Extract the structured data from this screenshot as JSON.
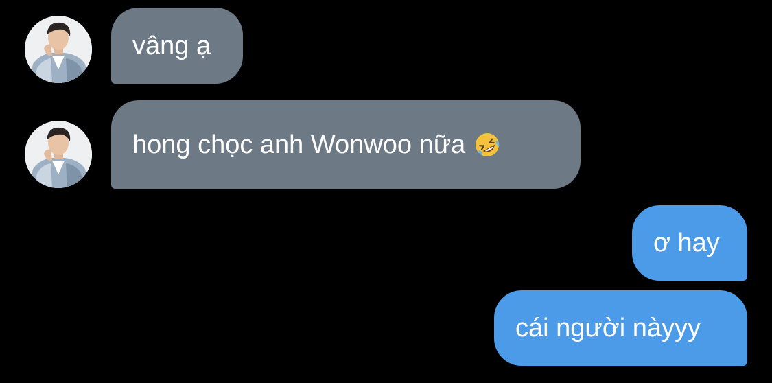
{
  "conversation": {
    "messages": [
      {
        "sender": "other",
        "text": "vâng ạ"
      },
      {
        "sender": "other",
        "text": "hong chọc anh Wonwoo nữa",
        "emoji": "rolling-on-floor-laughing-emoji"
      },
      {
        "sender": "self",
        "text": "ơ hay"
      },
      {
        "sender": "self",
        "text": "cái người nàyyy"
      }
    ]
  },
  "colors": {
    "background": "#000000",
    "incoming_bubble": "#6d7985",
    "outgoing_bubble": "#4c9be8",
    "text": "#ffffff"
  }
}
